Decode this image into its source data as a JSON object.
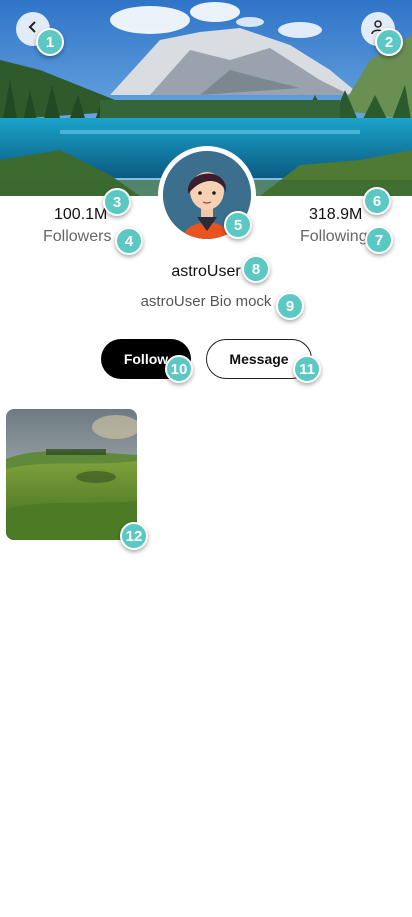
{
  "header": {
    "back_icon": "chevron-left-icon",
    "profile_icon": "person-icon"
  },
  "stats": {
    "followers": {
      "value": "100.1M",
      "label": "Followers"
    },
    "following": {
      "value": "318.9M",
      "label": "Following"
    }
  },
  "profile": {
    "username": "astroUser",
    "bio": "astroUser Bio mock"
  },
  "actions": {
    "follow_label": "Follow",
    "message_label": "Message"
  },
  "badges": [
    "1",
    "2",
    "3",
    "4",
    "5",
    "6",
    "7",
    "8",
    "9",
    "10",
    "11",
    "12"
  ],
  "colors": {
    "badge": "#5bc8c3",
    "follow_bg": "#000000",
    "accent_lake": "#1f8fb6"
  }
}
